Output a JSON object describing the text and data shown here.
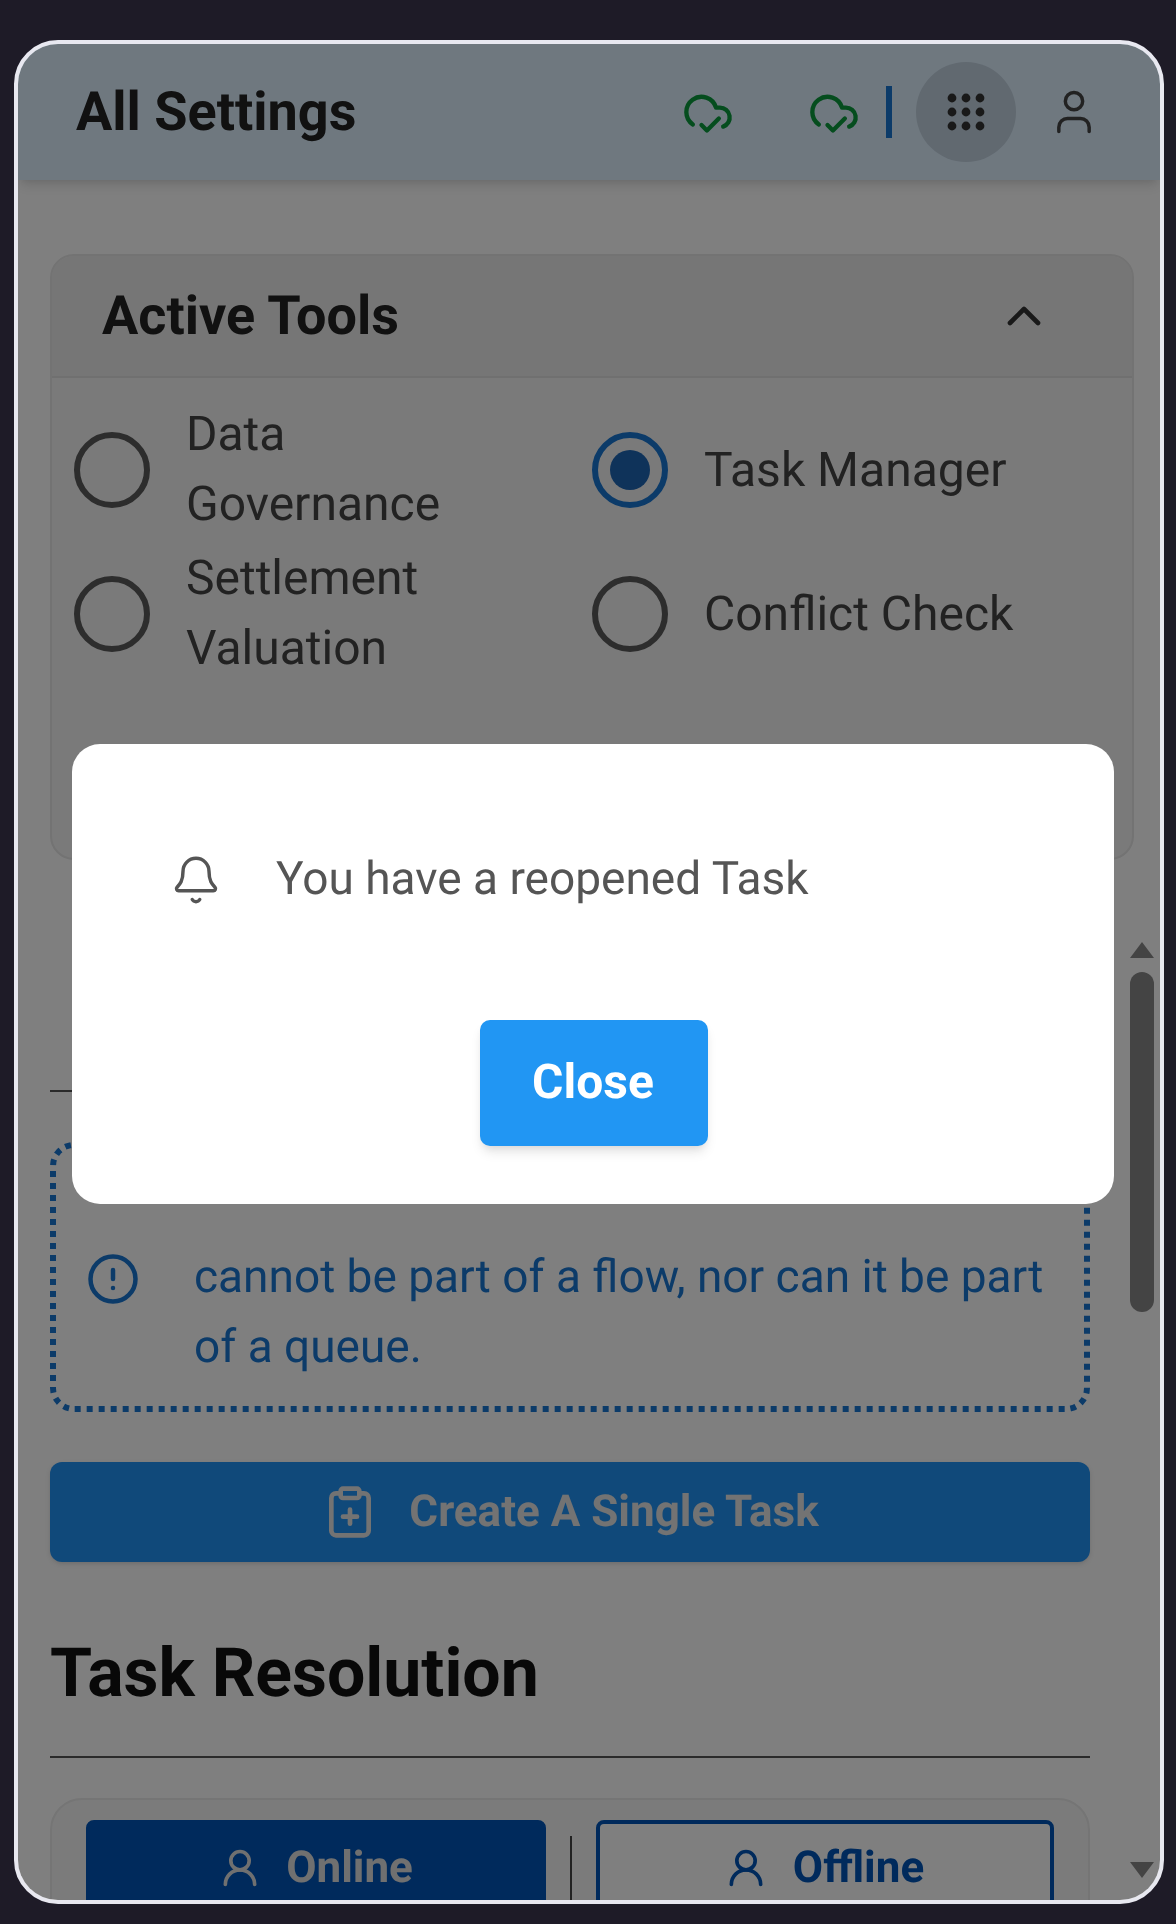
{
  "header": {
    "title": "All Settings"
  },
  "active_tools": {
    "title": "Active Tools",
    "expanded": true,
    "options": [
      {
        "label": "Data Governance",
        "selected": false
      },
      {
        "label": "Task Manager",
        "selected": true
      },
      {
        "label": "Settlement Valuation",
        "selected": false
      },
      {
        "label": "Conflict Check",
        "selected": false
      }
    ]
  },
  "info": "cannot be part of a flow, nor can it be part of a queue.",
  "create_button": "Create A Single Task",
  "task_resolution": {
    "title": "Task Resolution",
    "modes": [
      {
        "label": "Online",
        "selected": true
      },
      {
        "label": "Offline",
        "selected": false
      }
    ]
  },
  "dialog": {
    "message": "You have a reopened Task",
    "button": "Close"
  }
}
